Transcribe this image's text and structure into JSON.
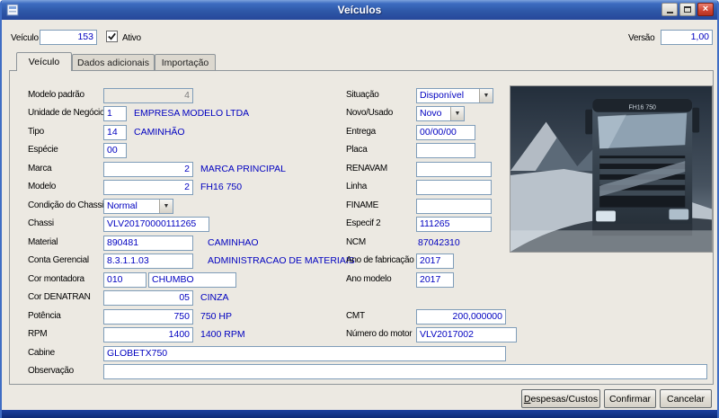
{
  "window": {
    "title": "Veículos"
  },
  "header": {
    "vehicle_label": "Veículo",
    "vehicle_value": "153",
    "active_label": "Ativo",
    "active_checked": true,
    "version_label": "Versão",
    "version_value": "1,00"
  },
  "tabs": {
    "vehicle": "Veículo",
    "additional": "Dados adicionais",
    "import": "Importação"
  },
  "fields": {
    "modelo_padrao": {
      "label": "Modelo padrão",
      "value": "4"
    },
    "unidade_negocio": {
      "label": "Unidade de Negócio",
      "code": "1",
      "desc": "EMPRESA MODELO LTDA"
    },
    "tipo": {
      "label": "Tipo",
      "code": "14",
      "desc": "CAMINHÃO"
    },
    "especie": {
      "label": "Espécie",
      "code": "00"
    },
    "marca": {
      "label": "Marca",
      "code": "2",
      "desc": "MARCA PRINCIPAL"
    },
    "modelo": {
      "label": "Modelo",
      "code": "2",
      "desc": "FH16 750"
    },
    "condicao_chassi": {
      "label": "Condição do Chassi",
      "value": "Normal"
    },
    "chassi": {
      "label": "Chassi",
      "value": "VLV20170000111265"
    },
    "material": {
      "label": "Material",
      "code": "890481",
      "desc": "CAMINHAO"
    },
    "conta_gerencial": {
      "label": "Conta Gerencial",
      "code": "8.3.1.1.03",
      "desc": "ADMINISTRACAO DE MATERIAIS"
    },
    "cor_montadora": {
      "label": "Cor montadora",
      "code": "010",
      "desc": "CHUMBO"
    },
    "cor_denatran": {
      "label": "Cor DENATRAN",
      "code": "05",
      "desc": "CINZA"
    },
    "potencia": {
      "label": "Potência",
      "code": "750",
      "desc": "750 HP"
    },
    "rpm": {
      "label": "RPM",
      "code": "1400",
      "desc": "1400 RPM"
    },
    "cabine": {
      "label": "Cabine",
      "value": "GLOBETX750"
    },
    "observacao": {
      "label": "Observação",
      "value": ""
    },
    "situacao": {
      "label": "Situação",
      "value": "Disponível"
    },
    "novo_usado": {
      "label": "Novo/Usado",
      "value": "Novo"
    },
    "entrega": {
      "label": "Entrega",
      "value": "00/00/00"
    },
    "placa": {
      "label": "Placa",
      "value": ""
    },
    "renavam": {
      "label": "RENAVAM",
      "value": ""
    },
    "linha": {
      "label": "Linha",
      "value": ""
    },
    "finame": {
      "label": "FINAME",
      "value": ""
    },
    "especif2": {
      "label": "Especif 2",
      "value": "111265"
    },
    "ncm": {
      "label": "NCM",
      "value": "87042310"
    },
    "ano_fabricacao": {
      "label": "Ano de fabricação",
      "value": "2017"
    },
    "ano_modelo": {
      "label": "Ano modelo",
      "value": "2017"
    },
    "cmt": {
      "label": "CMT",
      "value": "200,000000"
    },
    "numero_motor": {
      "label": "Número do motor",
      "value": "VLV2017002"
    }
  },
  "photo": {
    "badge": "FH16 750"
  },
  "buttons": {
    "despesas": "Despesas/Custos",
    "confirmar": "Confirmar",
    "cancelar": "Cancelar"
  },
  "colors": {
    "titlebar_blue": "#2e58a8",
    "field_text_blue": "#0000c0",
    "footer_navy": "#0d2b77",
    "close_red": "#cf4331"
  }
}
